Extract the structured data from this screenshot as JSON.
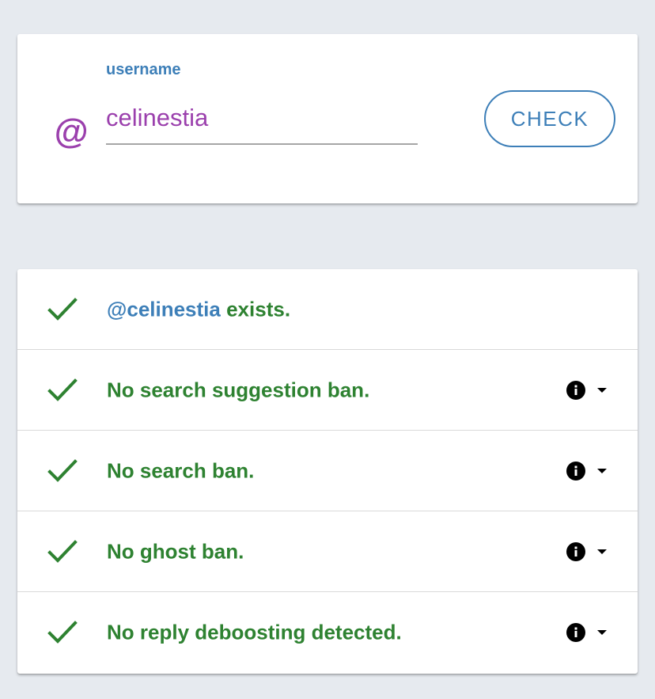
{
  "colors": {
    "background": "#e6eaef",
    "accent_blue": "#3d7fb8",
    "purple": "#9b40ad",
    "success_green": "#2e8231"
  },
  "input_card": {
    "label": "username",
    "icon": "at-sign-icon",
    "icon_glyph": "@",
    "username_value": "celinestia",
    "check_button_label": "CHECK"
  },
  "results": {
    "exists": {
      "handle": "@celinestia",
      "suffix": " exists.",
      "icon": "checkmark-icon"
    },
    "items": [
      {
        "label": "No search suggestion ban.",
        "status_icon": "checkmark-icon",
        "info_icon": "info-icon",
        "toggle_icon": "caret-down-icon"
      },
      {
        "label": "No search ban.",
        "status_icon": "checkmark-icon",
        "info_icon": "info-icon",
        "toggle_icon": "caret-down-icon"
      },
      {
        "label": "No ghost ban.",
        "status_icon": "checkmark-icon",
        "info_icon": "info-icon",
        "toggle_icon": "caret-down-icon"
      },
      {
        "label": "No reply deboosting detected.",
        "status_icon": "checkmark-icon",
        "info_icon": "info-icon",
        "toggle_icon": "caret-down-icon"
      }
    ]
  }
}
